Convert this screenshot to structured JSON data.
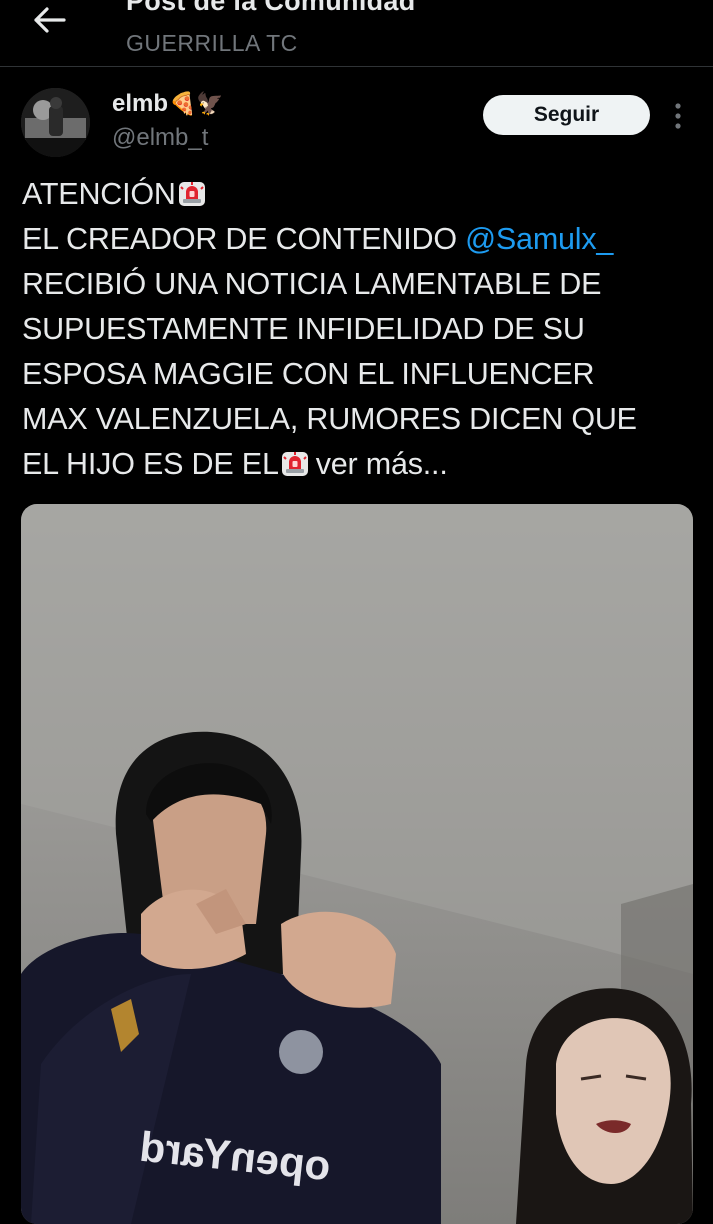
{
  "header": {
    "title": "Post de la Comunidad",
    "subtitle": "GUERRILLA TC",
    "back_icon": "arrow-left-icon"
  },
  "author": {
    "name": "elmb",
    "name_emojis": "🍕🦅",
    "handle": "@elmb_t",
    "follow_label": "Seguir",
    "more_icon": "vertical-ellipsis-icon"
  },
  "post": {
    "line1": "ATENCIÓN",
    "line2_prefix": "EL CREADOR DE CONTENIDO ",
    "mention": "@Samulx_",
    "line3": "RECIBIÓ UNA NOTICIA LAMENTABLE DE",
    "line4": "SUPUESTAMENTE INFIDELIDAD DE SU",
    "line5": "ESPOSA MAGGIE CON EL INFLUENCER",
    "line6": "MAX VALENZUELA, RUMORES DICEN QUE",
    "line7": "EL HIJO ES DE EL",
    "see_more": "ver más...",
    "siren_icon": "police-siren-emoji",
    "colors": {
      "mention": "#1d9bf0",
      "text": "#e7e9ea",
      "muted": "#71767b"
    }
  },
  "media": {
    "description_icon": "video-thumbnail",
    "shirt_text": "openYard"
  }
}
